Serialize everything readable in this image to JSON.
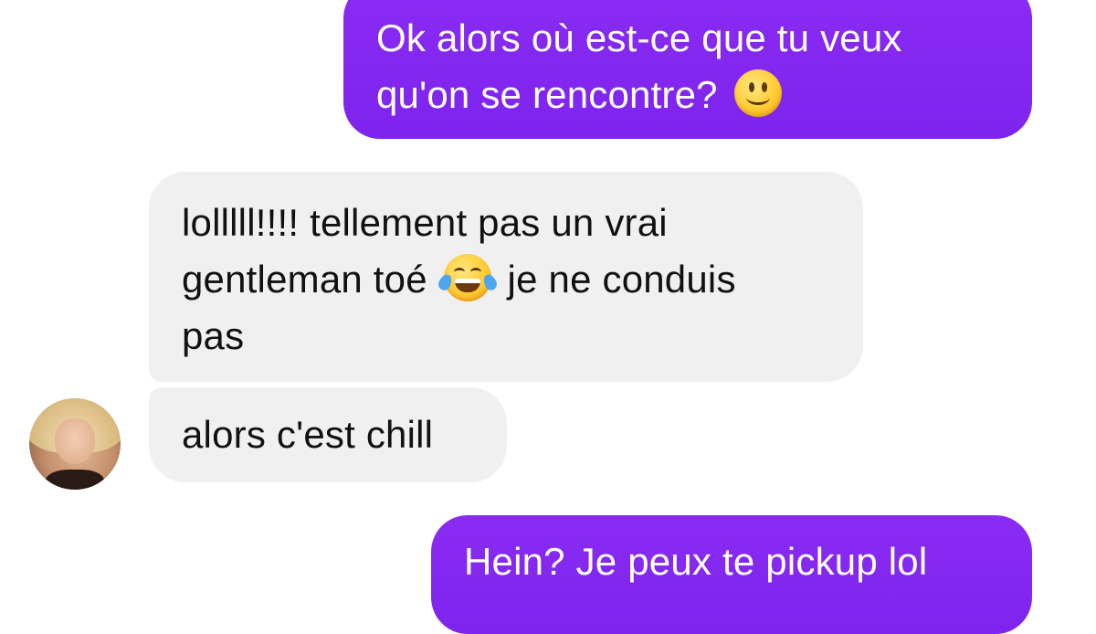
{
  "conversation": {
    "messages": [
      {
        "sender": "me",
        "lines": [
          "Ok alors où est-ce que tu veux",
          "qu'on se rencontre?"
        ],
        "emoji": "slightly-smiling-face"
      },
      {
        "sender": "contact",
        "line1": "lolllll!!!! tellement pas un vrai",
        "line2_before_emoji": "gentleman toé",
        "emoji": "face-with-tears-of-joy",
        "line2_after_emoji": "je ne conduis",
        "line3": "pas"
      },
      {
        "sender": "contact",
        "text": "alors c'est chill"
      },
      {
        "sender": "me",
        "text": "Hein? Je peux te pickup lol"
      }
    ]
  },
  "contact": {
    "avatar": "contact-avatar-photo"
  },
  "colors": {
    "sent_bubble": "#8a2bf2",
    "received_bubble": "#f1f0f0",
    "sent_text": "#ffffff",
    "received_text": "#111111",
    "background": "#ffffff"
  }
}
